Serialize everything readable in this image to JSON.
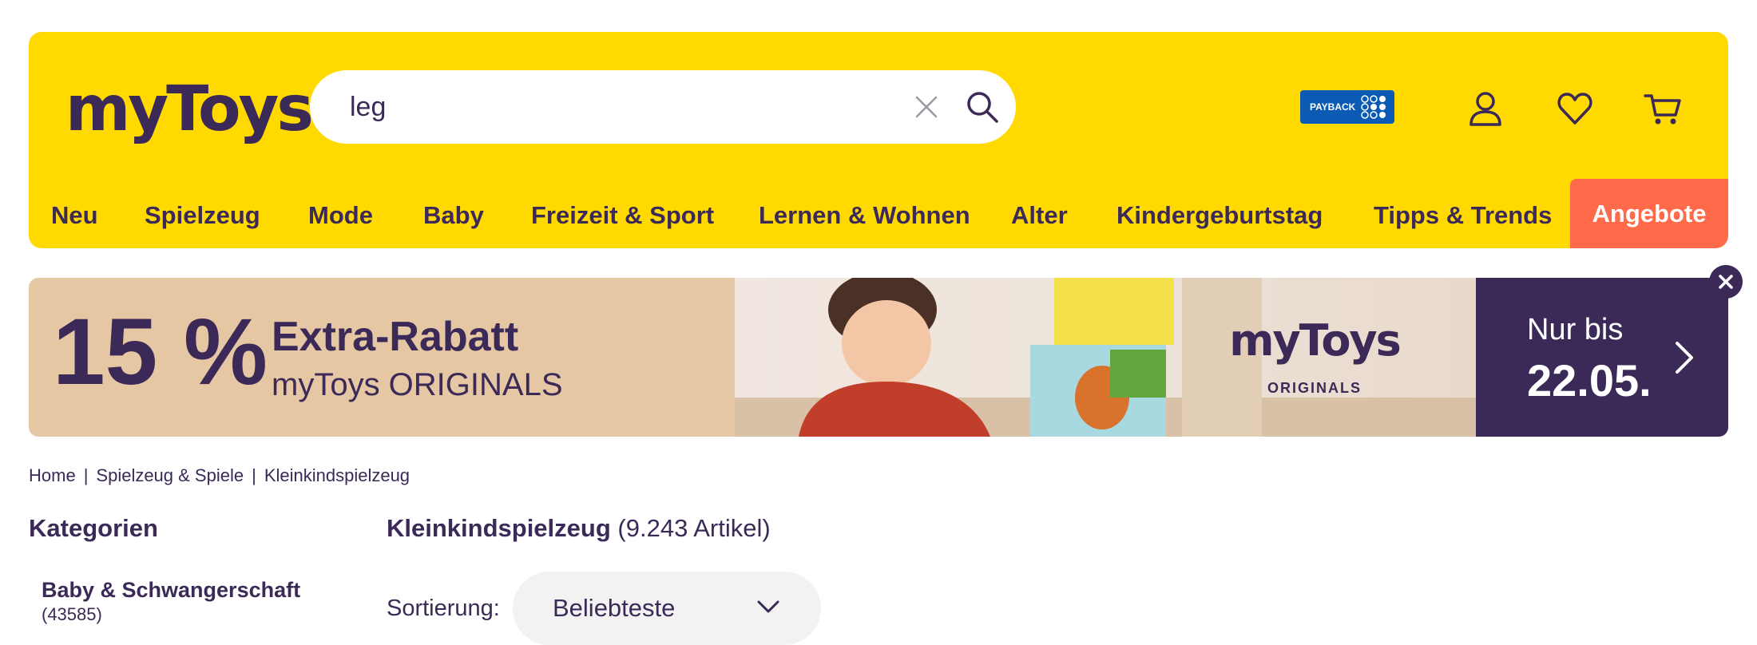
{
  "header": {
    "logo": "myToys",
    "search": {
      "value": "leg",
      "placeholder": ""
    },
    "icons": [
      "payback-icon",
      "account-icon",
      "heart-icon",
      "cart-icon"
    ],
    "payback_label": "PAYBACK"
  },
  "nav": {
    "items": [
      {
        "label": "Neu"
      },
      {
        "label": "Spielzeug"
      },
      {
        "label": "Mode"
      },
      {
        "label": "Baby"
      },
      {
        "label": "Freizeit & Sport"
      },
      {
        "label": "Lernen & Wohnen"
      },
      {
        "label": "Alter"
      },
      {
        "label": "Kindergeburtstag"
      },
      {
        "label": "Tipps & Trends"
      }
    ],
    "deals": "Angebote"
  },
  "banner": {
    "percent": "15 %",
    "title": "Extra-Rabatt",
    "subtitle": "myToys ORIGINALS",
    "brand": "myToys",
    "brand_sub": "ORIGINALS",
    "until": "Nur bis",
    "date": "22.05."
  },
  "breadcrumb": [
    "Home",
    "Spielzeug & Spiele",
    "Kleinkindspielzeug"
  ],
  "sidebar": {
    "heading": "Kategorien",
    "items": [
      {
        "name": "Baby & Schwangerschaft",
        "count": "(43585)"
      }
    ]
  },
  "results": {
    "title": "Kleinkindspielzeug",
    "count": "(9.243 Artikel)"
  },
  "sort": {
    "label": "Sortierung:",
    "value": "Beliebteste"
  },
  "colors": {
    "brand_yellow": "#ffd900",
    "brand_purple": "#3b2a57",
    "deals_orange": "#ff6b4a",
    "payback_blue": "#0b5bb5"
  }
}
